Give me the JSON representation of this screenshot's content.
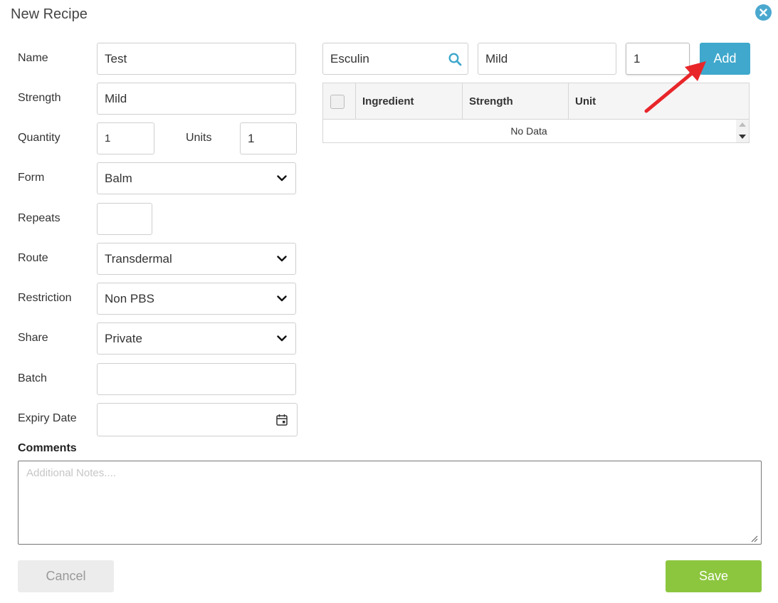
{
  "dialog": {
    "title": "New Recipe",
    "close_icon": "close-icon"
  },
  "form": {
    "name": {
      "label": "Name",
      "value": "Test"
    },
    "strength": {
      "label": "Strength",
      "value": "Mild"
    },
    "quantity": {
      "label": "Quantity",
      "value": "1"
    },
    "units": {
      "label": "Units",
      "value": "1"
    },
    "form": {
      "label": "Form",
      "value": "Balm"
    },
    "repeats": {
      "label": "Repeats",
      "value": ""
    },
    "route": {
      "label": "Route",
      "value": "Transdermal"
    },
    "restriction": {
      "label": "Restriction",
      "value": "Non PBS"
    },
    "share": {
      "label": "Share",
      "value": "Private"
    },
    "batch": {
      "label": "Batch",
      "value": ""
    },
    "expiry": {
      "label": "Expiry Date",
      "value": ""
    }
  },
  "comments": {
    "label": "Comments",
    "placeholder": "Additional Notes...."
  },
  "ingredient_entry": {
    "search_value": "Esculin",
    "strength_value": "Mild",
    "quantity_value": "1",
    "add_label": "Add"
  },
  "grid": {
    "columns": [
      "Ingredient",
      "Strength",
      "Unit"
    ],
    "empty_text": "No Data"
  },
  "actions": {
    "cancel_label": "Cancel",
    "save_label": "Save"
  },
  "colors": {
    "accent": "#3fa8cc",
    "save": "#8cc63f",
    "annotation_arrow": "#e8262a"
  }
}
